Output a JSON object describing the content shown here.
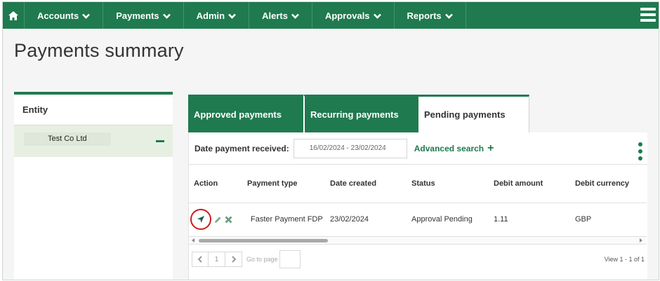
{
  "nav": {
    "home_icon": "home-icon",
    "items": [
      {
        "label": "Accounts"
      },
      {
        "label": "Payments"
      },
      {
        "label": "Admin"
      },
      {
        "label": "Alerts"
      },
      {
        "label": "Approvals"
      },
      {
        "label": "Reports"
      }
    ],
    "menu_icon": "hamburger-menu-icon"
  },
  "page": {
    "title": "Payments summary"
  },
  "entity_panel": {
    "header": "Entity",
    "entity_name": "Test Co Ltd",
    "collapse_icon": "minus-icon"
  },
  "tabs": [
    {
      "label": "Approved payments",
      "active": false
    },
    {
      "label": "Recurring payments",
      "active": false
    },
    {
      "label": "Pending payments",
      "active": true
    }
  ],
  "filter": {
    "label": "Date payment received:",
    "date_range": "16/02/2024 - 23/02/2024",
    "advanced_search": "Advanced search",
    "advanced_search_icon": "plus-icon",
    "more_icon": "kebab-menu-icon"
  },
  "table": {
    "columns": [
      "Action",
      "Payment type",
      "Date created",
      "Status",
      "Debit amount",
      "Debit currency"
    ],
    "rows": [
      {
        "action_icons": [
          "send-icon",
          "edit-icon",
          "delete-icon"
        ],
        "payment_type": "Faster Payment FDP",
        "date_created": "23/02/2024",
        "status": "Approval Pending",
        "debit_amount": "1.11",
        "debit_currency": "GBP"
      }
    ]
  },
  "pagination": {
    "current_page": "1",
    "goto_label": "Go to page",
    "goto_value": "",
    "view_count": "View 1 - 1 of 1"
  },
  "colors": {
    "brand_green": "#1f7a4f",
    "highlight_red": "#d11a1a",
    "entity_row_bg": "#e7efe3"
  }
}
